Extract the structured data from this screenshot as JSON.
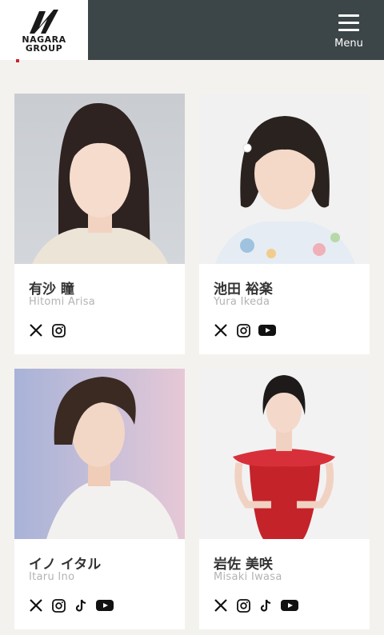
{
  "header": {
    "logo_line1": "NAGARA",
    "logo_line2": "GROUP",
    "menu_label": "Menu"
  },
  "colors": {
    "nav_background": "#3c4547",
    "page_background": "#f4f2ee",
    "accent_red": "#c9252b"
  },
  "talents": [
    {
      "name": "有沙 瞳",
      "romanized": "Hitomi Arisa",
      "socials": [
        "x-icon",
        "instagram-icon"
      ]
    },
    {
      "name": "池田 裕楽",
      "romanized": "Yura Ikeda",
      "socials": [
        "x-icon",
        "instagram-icon",
        "youtube-icon"
      ]
    },
    {
      "name": "イノ イタル",
      "romanized": "Itaru Ino",
      "socials": [
        "x-icon",
        "instagram-icon",
        "tiktok-icon",
        "youtube-icon"
      ]
    },
    {
      "name": "岩佐 美咲",
      "romanized": "Misaki Iwasa",
      "socials": [
        "x-icon",
        "instagram-icon",
        "tiktok-icon",
        "youtube-icon"
      ]
    }
  ]
}
